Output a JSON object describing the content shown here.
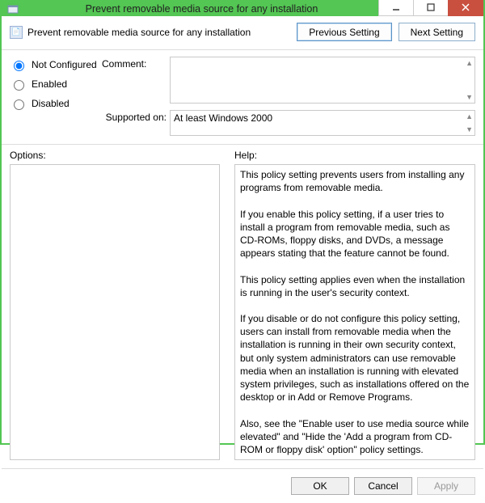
{
  "window": {
    "title": "Prevent removable media source for any installation"
  },
  "header": {
    "policy_label": "Prevent removable media source for any installation",
    "previous_setting": "Previous Setting",
    "next_setting": "Next Setting"
  },
  "radios": {
    "not_configured": "Not Configured",
    "enabled": "Enabled",
    "disabled": "Disabled",
    "selected": "not_configured"
  },
  "labels": {
    "comment": "Comment:",
    "supported_on": "Supported on:",
    "options": "Options:",
    "help": "Help:"
  },
  "fields": {
    "comment": "",
    "supported_on": "At least Windows 2000"
  },
  "help_text": "This policy setting prevents users from installing any programs from removable media.\n\nIf you enable this policy setting, if a user tries to install a program from removable media, such as CD-ROMs, floppy disks, and DVDs, a message appears stating that the feature cannot be found.\n\nThis policy setting applies even when the installation is running in the user's security context.\n\nIf you disable or do not configure this policy setting, users can install from removable media when the installation is running in their own security context, but only system administrators can use removable media when an installation is running with elevated system privileges, such as installations offered on the desktop or in Add or Remove Programs.\n\nAlso, see the \"Enable user to use media source while elevated\" and \"Hide the 'Add a program from CD-ROM or floppy disk' option\" policy settings.",
  "buttons": {
    "ok": "OK",
    "cancel": "Cancel",
    "apply": "Apply"
  }
}
